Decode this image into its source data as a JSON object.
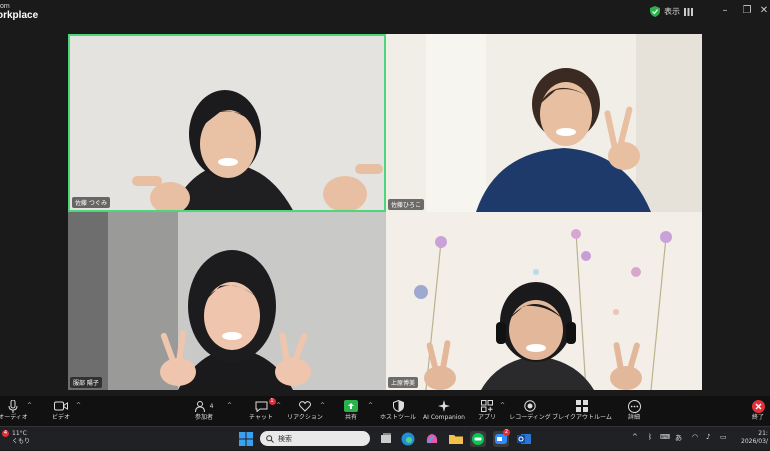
{
  "app": {
    "logo_line1": "om",
    "logo_line2": "orkplace",
    "view_label": "表示",
    "view_icon": "grid-icon"
  },
  "participants": [
    {
      "name": "佐藤 つぐみ",
      "active": true
    },
    {
      "name": "佐藤ひろこ",
      "active": false
    },
    {
      "name": "服部 陽子",
      "active": false
    },
    {
      "name": "上原博美",
      "active": false
    }
  ],
  "toolbar": {
    "audio": "オーディオ",
    "video": "ビデオ",
    "participants": "参加者",
    "participants_count": "4",
    "chat": "チャット",
    "chat_badge": "1",
    "reactions": "リアクション",
    "share": "共有",
    "host_tools": "ホストツール",
    "ai": "AI Companion",
    "apps": "アプリ",
    "recording": "レコーディング",
    "breakout": "ブレイクアウトルーム",
    "more": "詳細",
    "end": "終了"
  },
  "taskbar": {
    "temperature": "11°C",
    "weather": "くもり",
    "weather_badge": "4",
    "search_placeholder": "検索",
    "ime": "あ",
    "time": "21:",
    "date": "2026/03/",
    "app_badge": "2"
  }
}
